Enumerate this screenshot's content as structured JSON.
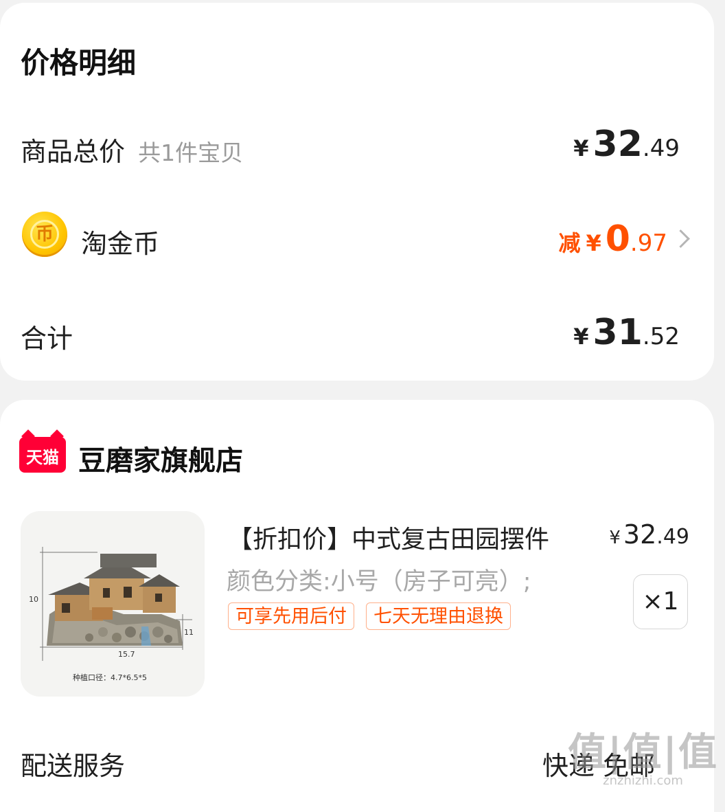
{
  "price_detail": {
    "title": "价格明细",
    "goods_total": {
      "label": "商品总价",
      "sub": "共1件宝贝",
      "currency": "¥",
      "int": "32",
      "dec": ".49"
    },
    "coin": {
      "icon_glyph": "币",
      "label": "淘金币",
      "prefix": "减",
      "currency": "¥",
      "int": "0",
      "dec": ".97"
    },
    "total": {
      "label": "合计",
      "currency": "¥",
      "int": "31",
      "dec": ".52"
    }
  },
  "store": {
    "badge": "天猫",
    "name": "豆磨家旗舰店",
    "product": {
      "title": "【折扣价】中式复古田园摆件",
      "sku": "颜色分类:小号（房子可亮）;",
      "price_currency": "¥",
      "price_int": "32",
      "price_dec": ".49",
      "quantity": "×1",
      "tags": [
        "可享先用后付",
        "七天无理由退换"
      ],
      "image": {
        "dim_height_left": "10",
        "dim_height_right": "11",
        "dim_width": "15.7",
        "caption": "种植口径：4.7*6.5*5"
      }
    },
    "delivery": {
      "label": "配送服务",
      "value": "快递 免邮"
    }
  },
  "watermark": {
    "text": "值|值|值",
    "url": "znzhizhi.com"
  },
  "colors": {
    "accent": "#ff5000",
    "tmall_red": "#ff0036",
    "coin_gold": "#ffc400"
  }
}
